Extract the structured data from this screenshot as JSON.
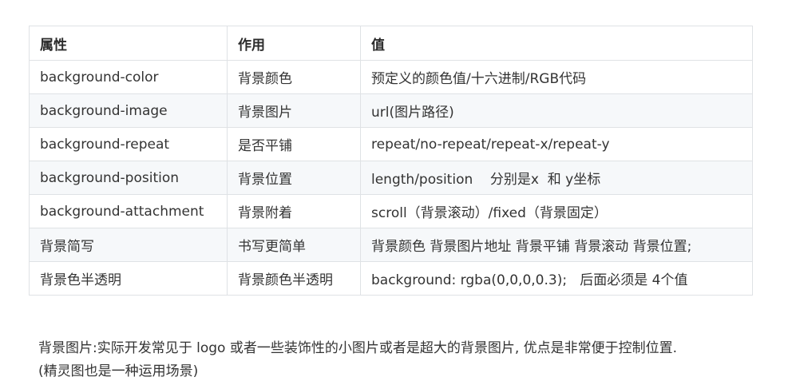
{
  "table": {
    "headers": [
      "属性",
      "作用",
      "值"
    ],
    "rows": [
      [
        "background-color",
        "背景颜色",
        "预定义的颜色值/十六进制/RGB代码"
      ],
      [
        "background-image",
        "背景图片",
        "url(图片路径)"
      ],
      [
        "background-repeat",
        "是否平铺",
        "repeat/no-repeat/repeat-x/repeat-y"
      ],
      [
        "background-position",
        "背景位置",
        "length/position    分别是x  和 y坐标"
      ],
      [
        "background-attachment",
        "背景附着",
        "scroll（背景滚动）/fixed（背景固定）"
      ],
      [
        "背景简写",
        "书写更简单",
        "背景颜色 背景图片地址 背景平铺 背景滚动 背景位置;"
      ],
      [
        "背景色半透明",
        "背景颜色半透明",
        "background: rgba(0,0,0,0.3);   后面必须是 4个值"
      ]
    ]
  },
  "note": {
    "line1": "背景图片:实际开发常见于 logo 或者一些装饰性的小图片或者是超大的背景图片, 优点是非常便于控制位置.",
    "line2": "(精灵图也是一种运用场景)"
  },
  "colors": {
    "border": "#dfe2e5",
    "stripe": "#f6f8fa",
    "text": "#333333"
  }
}
